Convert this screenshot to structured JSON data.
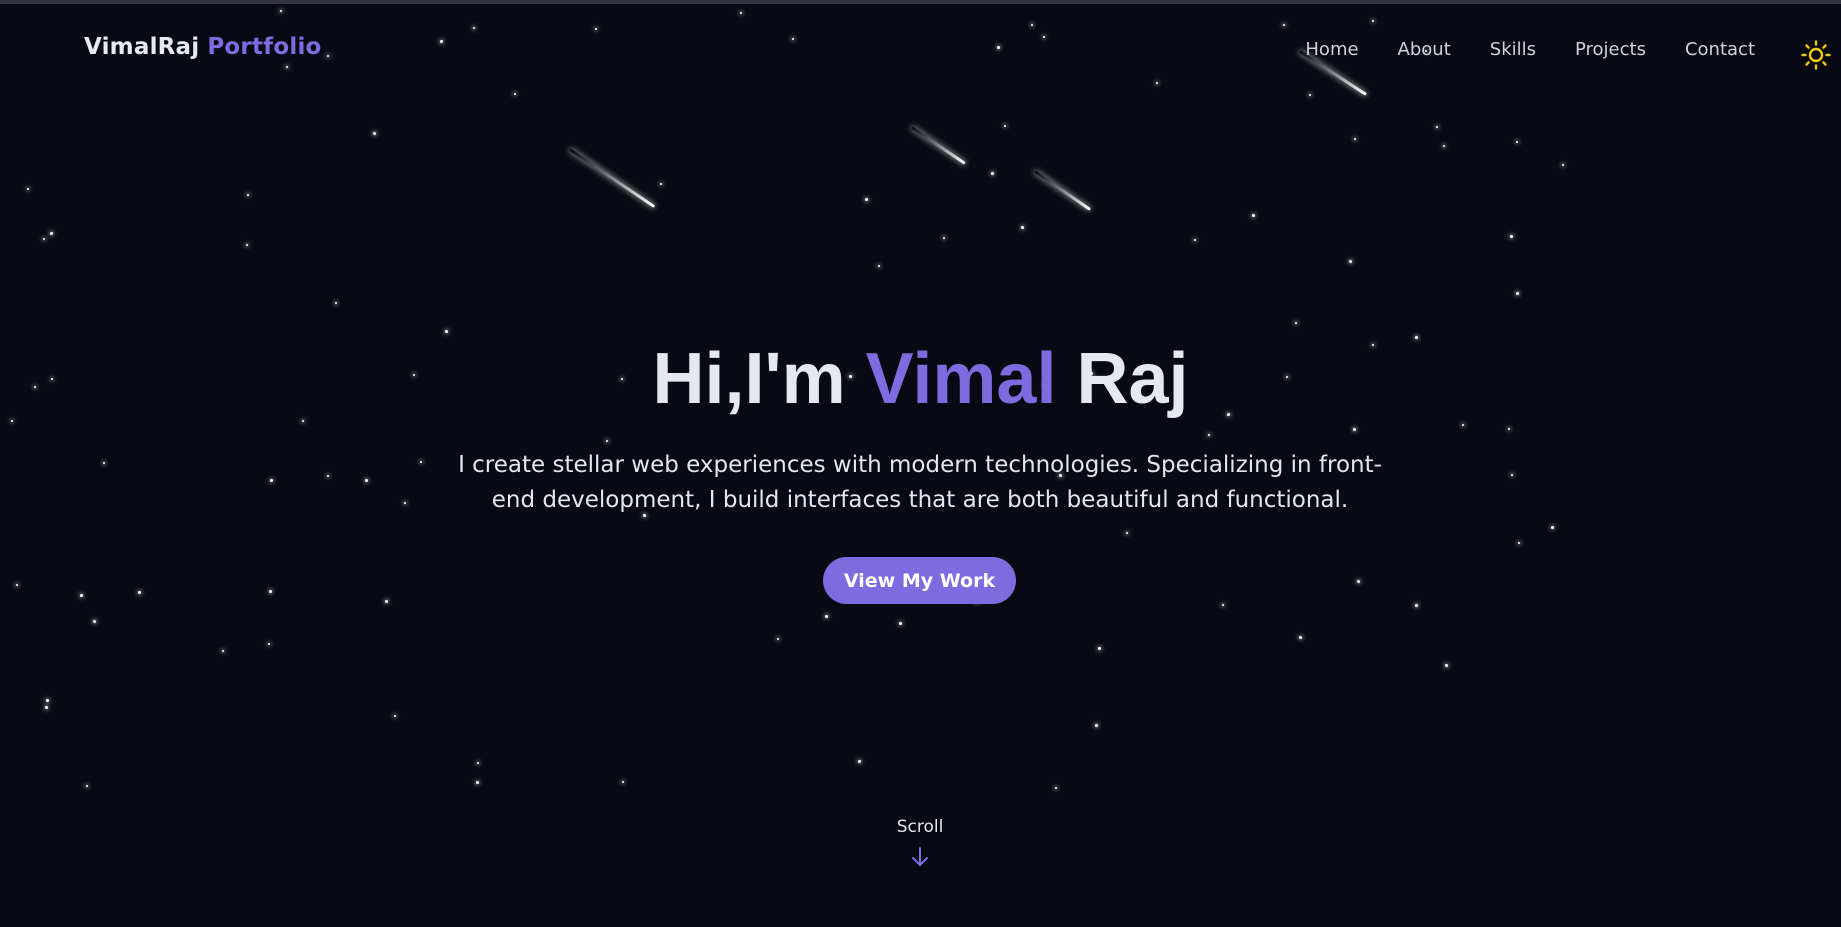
{
  "brand": {
    "first": "VimalRaj",
    "second": "Portfolio"
  },
  "nav": {
    "items": [
      {
        "label": "Home"
      },
      {
        "label": "About"
      },
      {
        "label": "Skills"
      },
      {
        "label": "Projects"
      },
      {
        "label": "Contact"
      }
    ],
    "theme_toggle_icon": "sun-icon"
  },
  "hero": {
    "greeting": "Hi,I'm",
    "first_name": "Vimal",
    "last_name": "Raj",
    "description": "I create stellar web experiences with modern technologies. Specializing in front-end development, I build interfaces that are both beautiful and functional.",
    "cta_label": "View My Work"
  },
  "scroll": {
    "label": "Scroll",
    "icon": "arrow-down-icon"
  },
  "colors": {
    "background": "#070a12",
    "accent": "#7f6be0",
    "text": "#e9eaf1",
    "sun": "#f2c81a"
  }
}
